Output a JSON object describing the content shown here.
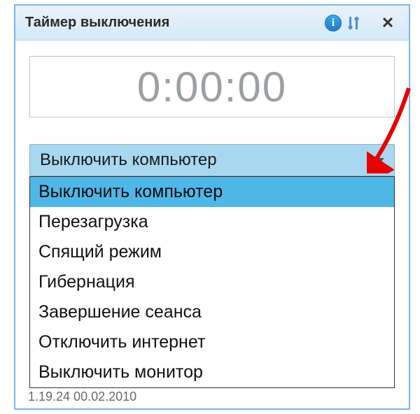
{
  "titlebar": {
    "title": "Таймер выключения",
    "info_glyph": "i",
    "close_glyph": "✕"
  },
  "timer": {
    "display": "0:00:00"
  },
  "dropdown": {
    "selected": "Выключить компьютер",
    "options": [
      "Выключить компьютер",
      "Перезагрузка",
      "Спящий режим",
      "Гибернация",
      "Завершение сеанса",
      "Отключить интернет",
      "Выключить монитор"
    ],
    "selected_index": 0
  },
  "status": {
    "text": "1.19.24   00.02.2010"
  },
  "annotation": {
    "color": "#e60000"
  }
}
